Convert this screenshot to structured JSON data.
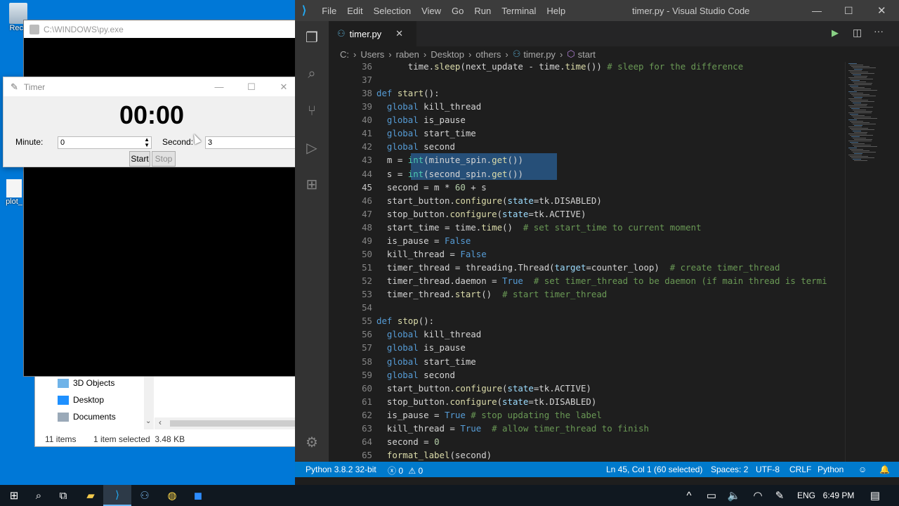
{
  "desktop": {
    "icons": [
      {
        "label": "Recy",
        "icon": "recycle-bin-icon"
      },
      {
        "label": "plot_",
        "icon": "file-icon"
      }
    ]
  },
  "console": {
    "title": "C:\\WINDOWS\\py.exe"
  },
  "explorer": {
    "items": [
      "3D Objects",
      "Desktop",
      "Documents"
    ],
    "status_items": "11 items",
    "status_selected": "1 item selected  3.48 KB"
  },
  "timer_window": {
    "title": "Timer",
    "display": "00:00",
    "minute_label": "Minute:",
    "minute_value": "0",
    "second_label": "Second:",
    "second_value": "3",
    "start_label": "Start",
    "stop_label": "Stop"
  },
  "vscode": {
    "window_title": "timer.py - Visual Studio Code",
    "menu": [
      "File",
      "Edit",
      "Selection",
      "View",
      "Go",
      "Run",
      "Terminal",
      "Help"
    ],
    "tab": "timer.py",
    "breadcrumb": [
      "C:",
      "Users",
      "raben",
      "Desktop",
      "others",
      "timer.py",
      "start"
    ],
    "status": {
      "python": "Python 3.8.2 32-bit",
      "errors": "0",
      "warnings": "0",
      "position": "Ln 45, Col 1 (60 selected)",
      "spaces": "Spaces: 2",
      "encoding": "UTF-8",
      "eol": "CRLF",
      "language": "Python"
    },
    "lines": [
      {
        "n": "36",
        "t": "      time.sleep(next_update - time.time()) # sleep for the difference"
      },
      {
        "n": "37",
        "t": ""
      },
      {
        "n": "38",
        "t": "def start():"
      },
      {
        "n": "39",
        "t": "  global kill_thread"
      },
      {
        "n": "40",
        "t": "  global is_pause"
      },
      {
        "n": "41",
        "t": "  global start_time"
      },
      {
        "n": "42",
        "t": "  global second"
      },
      {
        "n": "43",
        "t": "  m = int(minute_spin.get())"
      },
      {
        "n": "44",
        "t": "  s = int(second_spin.get())"
      },
      {
        "n": "45",
        "t": "  second = m * 60 + s"
      },
      {
        "n": "46",
        "t": "  start_button.configure(state=tk.DISABLED)"
      },
      {
        "n": "47",
        "t": "  stop_button.configure(state=tk.ACTIVE)"
      },
      {
        "n": "48",
        "t": "  start_time = time.time()  # set start_time to current moment"
      },
      {
        "n": "49",
        "t": "  is_pause = False"
      },
      {
        "n": "50",
        "t": "  kill_thread = False"
      },
      {
        "n": "51",
        "t": "  timer_thread = threading.Thread(target=counter_loop)  # create timer_thread"
      },
      {
        "n": "52",
        "t": "  timer_thread.daemon = True  # set timer_thread to be daemon (if main thread is termi"
      },
      {
        "n": "53",
        "t": "  timer_thread.start()  # start timer_thread"
      },
      {
        "n": "54",
        "t": ""
      },
      {
        "n": "55",
        "t": "def stop():"
      },
      {
        "n": "56",
        "t": "  global kill_thread"
      },
      {
        "n": "57",
        "t": "  global is_pause"
      },
      {
        "n": "58",
        "t": "  global start_time"
      },
      {
        "n": "59",
        "t": "  global second"
      },
      {
        "n": "60",
        "t": "  start_button.configure(state=tk.ACTIVE)"
      },
      {
        "n": "61",
        "t": "  stop_button.configure(state=tk.DISABLED)"
      },
      {
        "n": "62",
        "t": "  is_pause = True # stop updating the label"
      },
      {
        "n": "63",
        "t": "  kill_thread = True  # allow timer_thread to finish"
      },
      {
        "n": "64",
        "t": "  second = 0"
      },
      {
        "n": "65",
        "t": "  format_label(second)"
      }
    ]
  },
  "taskbar": {
    "language": "ENG",
    "time": "6:49 PM"
  },
  "colors": {
    "desktop": "#0078d7",
    "vscode_status": "#007acc",
    "selection": "#264f78"
  }
}
